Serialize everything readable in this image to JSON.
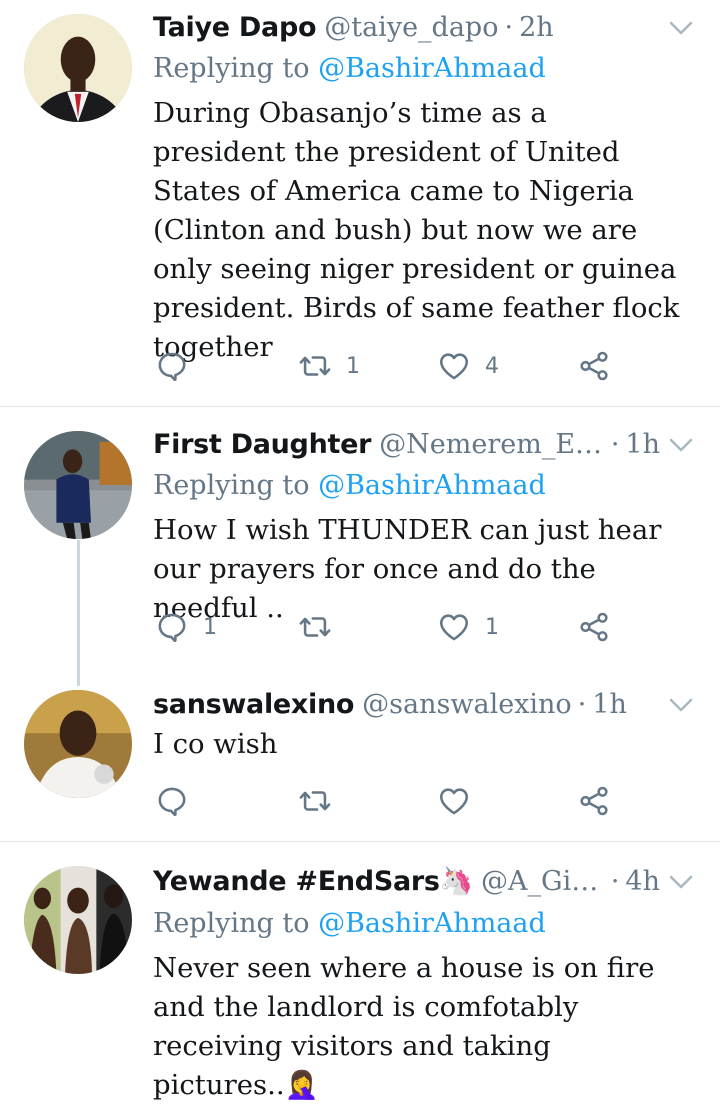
{
  "colors": {
    "text": "#14171a",
    "muted": "#657786",
    "link": "#1da1f2",
    "divider": "#e1e8ed"
  },
  "tweets": [
    {
      "name": "Taiye Dapo",
      "handle": "@taiye_dapo",
      "time": "2h",
      "replying_prefix": "Replying to",
      "replying_to": "@BashirAhmaad",
      "text": "During Obasanjo’s time as a president the president of United States of America came to Nigeria (Clinton and bush) but now we are only seeing niger president or guinea president. Birds of same feather flock together",
      "replies": "",
      "retweets": "1",
      "likes": "4",
      "icons": [
        "reply-icon",
        "retweet-icon",
        "like-icon",
        "share-icon"
      ]
    },
    {
      "name": "First Daughter",
      "handle": "@Nemerem_Eze...",
      "time": "1h",
      "replying_prefix": "Replying to",
      "replying_to": "@BashirAhmaad",
      "text": "How I wish THUNDER can just hear our prayers for once and do the needful ..",
      "replies": "1",
      "retweets": "",
      "likes": "1"
    },
    {
      "name": "sanswalexino",
      "handle": "@sanswalexino",
      "time": "1h",
      "text": "I co wish",
      "replies": "",
      "retweets": "",
      "likes": ""
    },
    {
      "name": "Yewande #EndSars🦄",
      "handle": "@A_Girl...",
      "time": "4h",
      "replying_prefix": "Replying to",
      "replying_to": "@BashirAhmaad",
      "text": "Never seen where a house is on fire and the landlord is comfotably receiving visitors and taking pictures..🤦‍♀️"
    }
  ]
}
